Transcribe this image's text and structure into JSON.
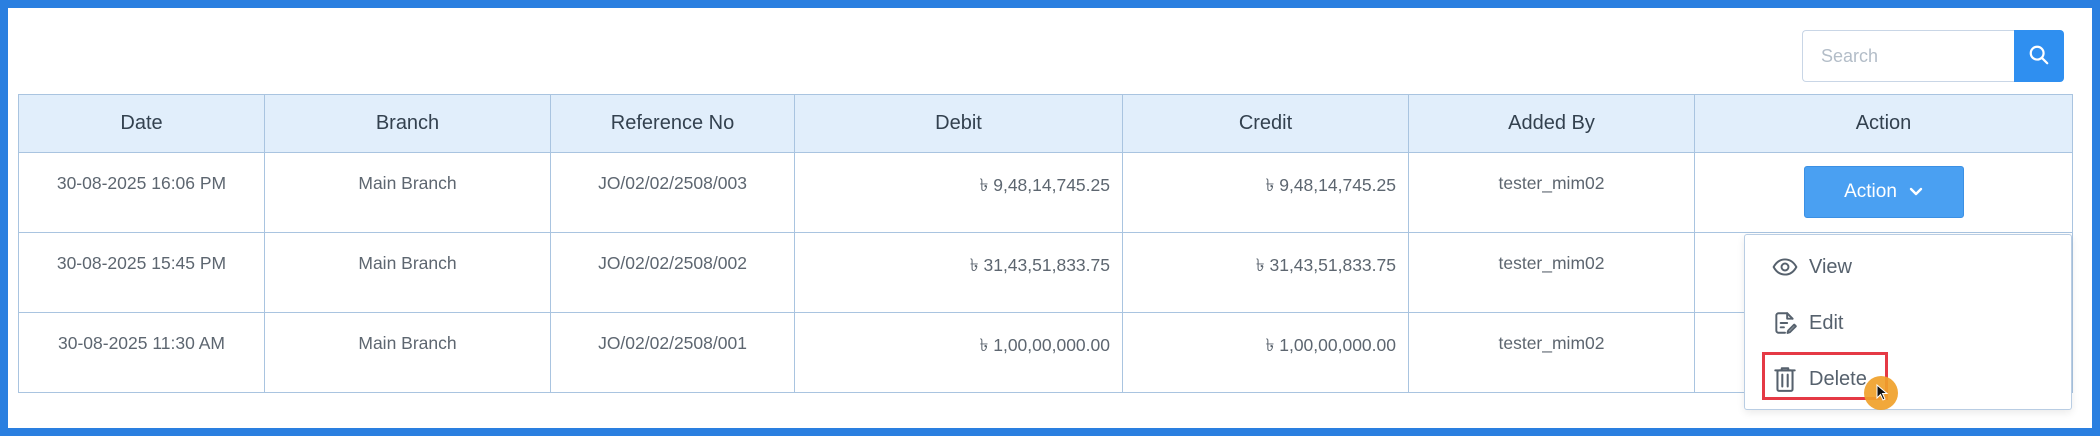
{
  "search": {
    "placeholder": "Search"
  },
  "table": {
    "headers": [
      "Date",
      "Branch",
      "Reference No",
      "Debit",
      "Credit",
      "Added By",
      "Action"
    ],
    "rows": [
      {
        "date": "30-08-2025 16:06 PM",
        "branch": "Main Branch",
        "reference": "JO/02/02/2508/003",
        "debit": "৳ 9,48,14,745.25",
        "credit": "৳ 9,48,14,745.25",
        "added_by": "tester_mim02"
      },
      {
        "date": "30-08-2025 15:45 PM",
        "branch": "Main Branch",
        "reference": "JO/02/02/2508/002",
        "debit": "৳ 31,43,51,833.75",
        "credit": "৳ 31,43,51,833.75",
        "added_by": "tester_mim02"
      },
      {
        "date": "30-08-2025 11:30 AM",
        "branch": "Main Branch",
        "reference": "JO/02/02/2508/001",
        "debit": "৳ 1,00,00,000.00",
        "credit": "৳ 1,00,00,000.00",
        "added_by": "tester_mim02"
      }
    ],
    "action_button_label": "Action"
  },
  "dropdown": {
    "items": [
      {
        "label": "View",
        "icon": "eye-icon"
      },
      {
        "label": "Edit",
        "icon": "edit-document-icon"
      },
      {
        "label": "Delete",
        "icon": "trash-icon"
      }
    ]
  },
  "colors": {
    "frame_border": "#2a7fe0",
    "header_bg": "#e1eefb",
    "primary_button": "#4aa0f2",
    "highlight": "#e53945",
    "cursor": "#f0a12a"
  }
}
